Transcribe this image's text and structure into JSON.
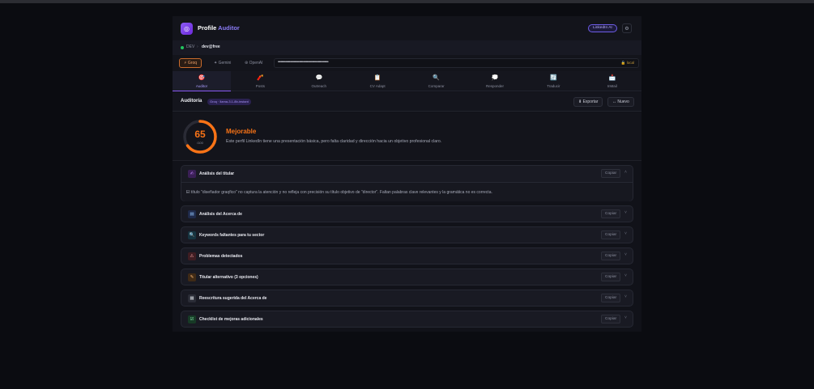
{
  "app": {
    "brand_primary": "Profile",
    "brand_accent": "Auditor",
    "logo_icon": "target-icon",
    "linkedin_badge": "LinkedIn AI"
  },
  "breadcrumb": {
    "env": "DEV",
    "separator": "›",
    "user": "dev@free"
  },
  "providers": [
    {
      "label": "⚡ Groq",
      "active": true
    },
    {
      "label": "✦ Gemini",
      "active": false
    },
    {
      "label": "⊛ OpenAI",
      "active": false
    }
  ],
  "api_key": {
    "value": "••••••••••••••••••••••••••••••••••••••••••••••••••••••",
    "badge": "🔒 local"
  },
  "tabs": [
    {
      "icon": "🎯",
      "label": "Auditor",
      "active": true
    },
    {
      "icon": "🧨",
      "label": "Posts",
      "active": false
    },
    {
      "icon": "💬",
      "label": "Outreach",
      "active": false
    },
    {
      "icon": "📋",
      "label": "CV Adapt",
      "active": false
    },
    {
      "icon": "🔍",
      "label": "Comparar",
      "active": false
    },
    {
      "icon": "💭",
      "label": "Responder",
      "active": false
    },
    {
      "icon": "🔄",
      "label": "Traducir",
      "active": false
    },
    {
      "icon": "📩",
      "label": "InMail",
      "active": false
    }
  ],
  "audit": {
    "title": "Auditoría",
    "model_badge": "Groq · llama-3.1-8b-instant",
    "export_label": "⬇ Exportar",
    "new_label": "↔ Nuevo"
  },
  "score": {
    "value": "65",
    "denominator": "/100",
    "fraction": 0.65,
    "label": "Mejorable",
    "description": "Este perfil LinkedIn tiene una presentación básica, pero falta claridad y dirección hacia un objetivo profesional claro.",
    "color": "#f97316"
  },
  "sections": [
    {
      "icon": "✍",
      "icon_color": "#c084fc",
      "icon_bg": "#3a1f55",
      "title": "Análisis del titular",
      "copy": "Copiar",
      "chevron": "˄",
      "expanded": true,
      "body": "El título \"diseñador graqfico\" no captura la atención y no refleja con precisión su título objetivo de \"director\". Faltan palabras clave relevantes y la gramática no es correcta."
    },
    {
      "icon": "▤",
      "icon_color": "#93c5fd",
      "icon_bg": "#1f2a4a",
      "title": "Análisis del Acerca de",
      "copy": "Copiar",
      "chevron": "˅",
      "expanded": false
    },
    {
      "icon": "🔍",
      "icon_color": "#67e8f9",
      "icon_bg": "#163440",
      "title": "Keywords faltantes para tu sector",
      "copy": "Copiar",
      "chevron": "˅",
      "expanded": false
    },
    {
      "icon": "⚠",
      "icon_color": "#fca5a5",
      "icon_bg": "#3f1d22",
      "title": "Problemas detectados",
      "copy": "Copiar",
      "chevron": "˅",
      "expanded": false
    },
    {
      "icon": "✎",
      "icon_color": "#fdba74",
      "icon_bg": "#3f2a16",
      "title": "Titular alternativo (3 opciones)",
      "copy": "Copiar",
      "chevron": "˅",
      "expanded": false
    },
    {
      "icon": "▦",
      "icon_color": "#d1d5db",
      "icon_bg": "#2a2c36",
      "title": "Reescritura sugerida del Acerca de",
      "copy": "Copiar",
      "chevron": "˅",
      "expanded": false
    },
    {
      "icon": "☑",
      "icon_color": "#86efac",
      "icon_bg": "#173a26",
      "title": "Checklist de mejoras adicionales",
      "copy": "Copiar",
      "chevron": "˅",
      "expanded": false
    }
  ]
}
